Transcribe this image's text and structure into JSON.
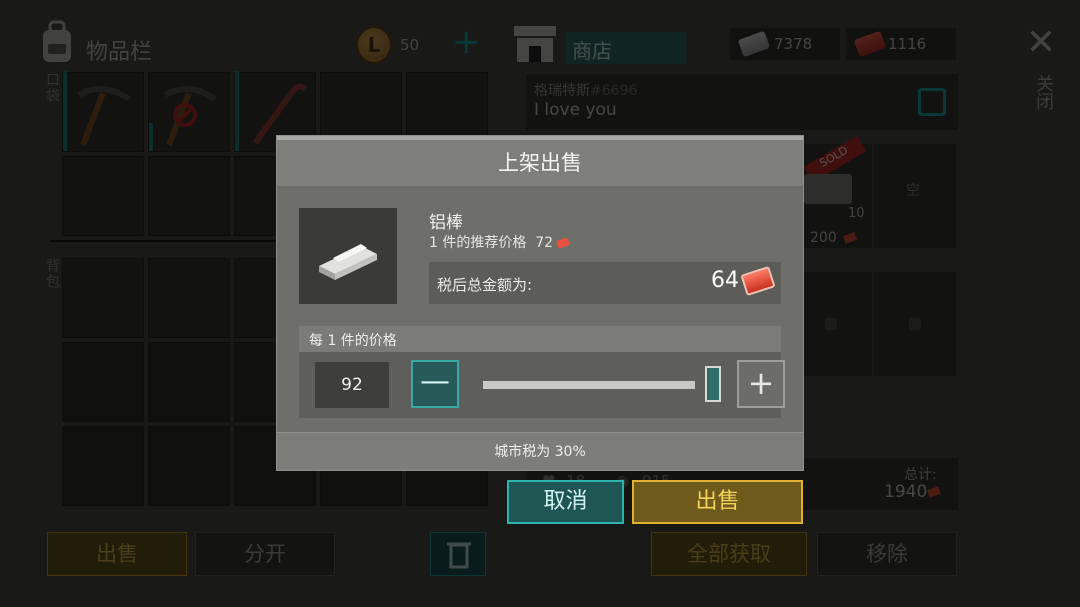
{
  "inventory": {
    "title": "物品栏",
    "coins": "50",
    "pocket_label": "口袋",
    "backpack_label": "背包"
  },
  "shop": {
    "title": "商店",
    "silver_tickets": "7378",
    "red_tickets": "1116",
    "close_label": "关闭"
  },
  "message": {
    "name": "格瑞特斯",
    "tag": "#6696",
    "text": "I love you"
  },
  "market": {
    "badge": "SOLD",
    "item_count": "10",
    "item_price": "200",
    "empty_label": "空",
    "likes": "18",
    "views": "915",
    "total_label": "总计:",
    "total_value": "1940"
  },
  "bottom": {
    "sell": "出售",
    "split": "分开",
    "take_all": "全部获取",
    "remove": "移除"
  },
  "dialog": {
    "title": "上架出售",
    "item_name": "铝棒",
    "rec_price_label": "1 件的推荐价格",
    "rec_price_value": "72",
    "after_tax_label": "税后总金额为:",
    "after_tax_value": "64",
    "per_item_label": "每 1 件的价格",
    "price_value": "92",
    "minus": "—",
    "plus": "+",
    "tax_note": "城市税为 30%",
    "cancel": "取消",
    "confirm": "出售",
    "slider_level": 1.0
  },
  "colors": {
    "accent_teal": "#2db2ae",
    "accent_gold": "#e0b032",
    "ticket_red": "#e8523e"
  }
}
